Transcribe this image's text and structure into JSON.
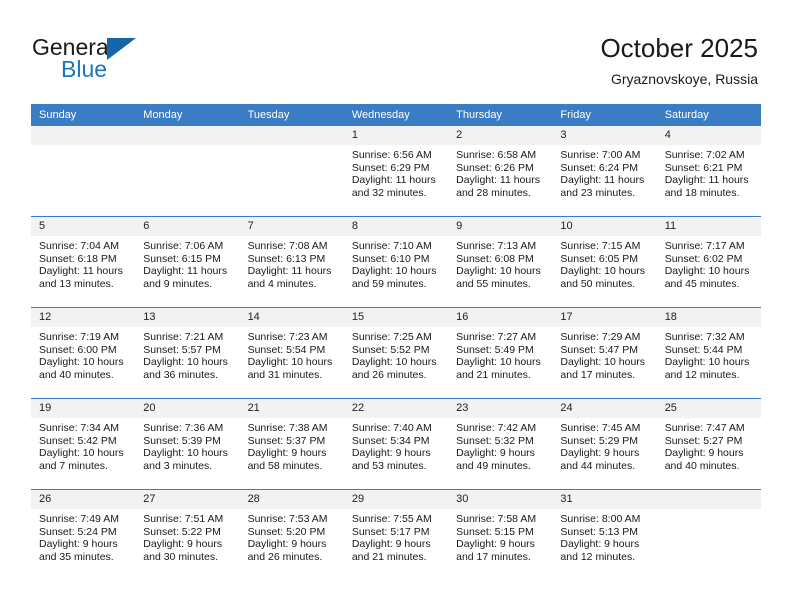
{
  "brand": {
    "word_one": "General",
    "word_two": "Blue",
    "accent_color": "#1b74c4",
    "triangle_color": "#1565a8",
    "logo_icon": "general-blue-logo"
  },
  "header": {
    "title": "October 2025",
    "location": "Gryaznovskoye, Russia"
  },
  "calendar": {
    "header_color": "#3b7dc4",
    "daynum_bg": "#f2f2f2",
    "weekdays": [
      "Sunday",
      "Monday",
      "Tuesday",
      "Wednesday",
      "Thursday",
      "Friday",
      "Saturday"
    ],
    "weeks": [
      [
        {
          "day": "",
          "lines": []
        },
        {
          "day": "",
          "lines": []
        },
        {
          "day": "",
          "lines": []
        },
        {
          "day": "1",
          "lines": [
            "Sunrise: 6:56 AM",
            "Sunset: 6:29 PM",
            "Daylight: 11 hours",
            "and 32 minutes."
          ]
        },
        {
          "day": "2",
          "lines": [
            "Sunrise: 6:58 AM",
            "Sunset: 6:26 PM",
            "Daylight: 11 hours",
            "and 28 minutes."
          ]
        },
        {
          "day": "3",
          "lines": [
            "Sunrise: 7:00 AM",
            "Sunset: 6:24 PM",
            "Daylight: 11 hours",
            "and 23 minutes."
          ]
        },
        {
          "day": "4",
          "lines": [
            "Sunrise: 7:02 AM",
            "Sunset: 6:21 PM",
            "Daylight: 11 hours",
            "and 18 minutes."
          ]
        }
      ],
      [
        {
          "day": "5",
          "lines": [
            "Sunrise: 7:04 AM",
            "Sunset: 6:18 PM",
            "Daylight: 11 hours",
            "and 13 minutes."
          ]
        },
        {
          "day": "6",
          "lines": [
            "Sunrise: 7:06 AM",
            "Sunset: 6:15 PM",
            "Daylight: 11 hours",
            "and 9 minutes."
          ]
        },
        {
          "day": "7",
          "lines": [
            "Sunrise: 7:08 AM",
            "Sunset: 6:13 PM",
            "Daylight: 11 hours",
            "and 4 minutes."
          ]
        },
        {
          "day": "8",
          "lines": [
            "Sunrise: 7:10 AM",
            "Sunset: 6:10 PM",
            "Daylight: 10 hours",
            "and 59 minutes."
          ]
        },
        {
          "day": "9",
          "lines": [
            "Sunrise: 7:13 AM",
            "Sunset: 6:08 PM",
            "Daylight: 10 hours",
            "and 55 minutes."
          ]
        },
        {
          "day": "10",
          "lines": [
            "Sunrise: 7:15 AM",
            "Sunset: 6:05 PM",
            "Daylight: 10 hours",
            "and 50 minutes."
          ]
        },
        {
          "day": "11",
          "lines": [
            "Sunrise: 7:17 AM",
            "Sunset: 6:02 PM",
            "Daylight: 10 hours",
            "and 45 minutes."
          ]
        }
      ],
      [
        {
          "day": "12",
          "lines": [
            "Sunrise: 7:19 AM",
            "Sunset: 6:00 PM",
            "Daylight: 10 hours",
            "and 40 minutes."
          ]
        },
        {
          "day": "13",
          "lines": [
            "Sunrise: 7:21 AM",
            "Sunset: 5:57 PM",
            "Daylight: 10 hours",
            "and 36 minutes."
          ]
        },
        {
          "day": "14",
          "lines": [
            "Sunrise: 7:23 AM",
            "Sunset: 5:54 PM",
            "Daylight: 10 hours",
            "and 31 minutes."
          ]
        },
        {
          "day": "15",
          "lines": [
            "Sunrise: 7:25 AM",
            "Sunset: 5:52 PM",
            "Daylight: 10 hours",
            "and 26 minutes."
          ]
        },
        {
          "day": "16",
          "lines": [
            "Sunrise: 7:27 AM",
            "Sunset: 5:49 PM",
            "Daylight: 10 hours",
            "and 21 minutes."
          ]
        },
        {
          "day": "17",
          "lines": [
            "Sunrise: 7:29 AM",
            "Sunset: 5:47 PM",
            "Daylight: 10 hours",
            "and 17 minutes."
          ]
        },
        {
          "day": "18",
          "lines": [
            "Sunrise: 7:32 AM",
            "Sunset: 5:44 PM",
            "Daylight: 10 hours",
            "and 12 minutes."
          ]
        }
      ],
      [
        {
          "day": "19",
          "lines": [
            "Sunrise: 7:34 AM",
            "Sunset: 5:42 PM",
            "Daylight: 10 hours",
            "and 7 minutes."
          ]
        },
        {
          "day": "20",
          "lines": [
            "Sunrise: 7:36 AM",
            "Sunset: 5:39 PM",
            "Daylight: 10 hours",
            "and 3 minutes."
          ]
        },
        {
          "day": "21",
          "lines": [
            "Sunrise: 7:38 AM",
            "Sunset: 5:37 PM",
            "Daylight: 9 hours",
            "and 58 minutes."
          ]
        },
        {
          "day": "22",
          "lines": [
            "Sunrise: 7:40 AM",
            "Sunset: 5:34 PM",
            "Daylight: 9 hours",
            "and 53 minutes."
          ]
        },
        {
          "day": "23",
          "lines": [
            "Sunrise: 7:42 AM",
            "Sunset: 5:32 PM",
            "Daylight: 9 hours",
            "and 49 minutes."
          ]
        },
        {
          "day": "24",
          "lines": [
            "Sunrise: 7:45 AM",
            "Sunset: 5:29 PM",
            "Daylight: 9 hours",
            "and 44 minutes."
          ]
        },
        {
          "day": "25",
          "lines": [
            "Sunrise: 7:47 AM",
            "Sunset: 5:27 PM",
            "Daylight: 9 hours",
            "and 40 minutes."
          ]
        }
      ],
      [
        {
          "day": "26",
          "lines": [
            "Sunrise: 7:49 AM",
            "Sunset: 5:24 PM",
            "Daylight: 9 hours",
            "and 35 minutes."
          ]
        },
        {
          "day": "27",
          "lines": [
            "Sunrise: 7:51 AM",
            "Sunset: 5:22 PM",
            "Daylight: 9 hours",
            "and 30 minutes."
          ]
        },
        {
          "day": "28",
          "lines": [
            "Sunrise: 7:53 AM",
            "Sunset: 5:20 PM",
            "Daylight: 9 hours",
            "and 26 minutes."
          ]
        },
        {
          "day": "29",
          "lines": [
            "Sunrise: 7:55 AM",
            "Sunset: 5:17 PM",
            "Daylight: 9 hours",
            "and 21 minutes."
          ]
        },
        {
          "day": "30",
          "lines": [
            "Sunrise: 7:58 AM",
            "Sunset: 5:15 PM",
            "Daylight: 9 hours",
            "and 17 minutes."
          ]
        },
        {
          "day": "31",
          "lines": [
            "Sunrise: 8:00 AM",
            "Sunset: 5:13 PM",
            "Daylight: 9 hours",
            "and 12 minutes."
          ]
        },
        {
          "day": "",
          "lines": []
        }
      ]
    ]
  }
}
